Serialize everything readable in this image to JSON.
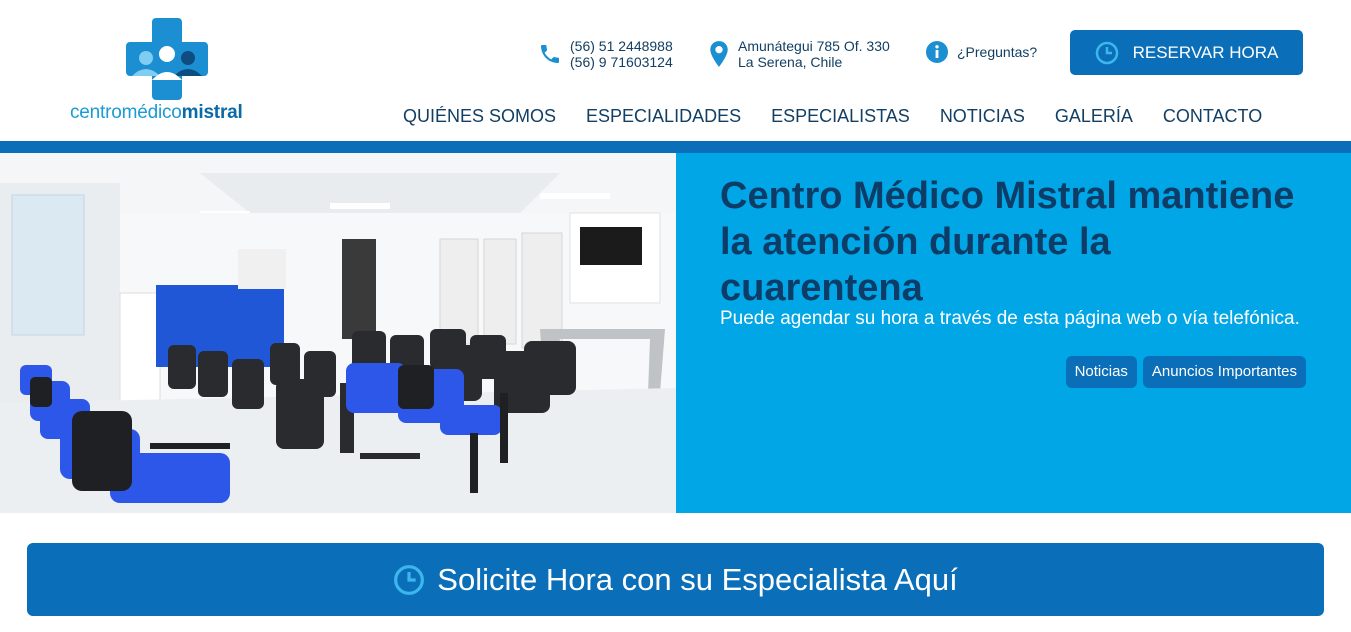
{
  "header": {
    "logo": {
      "text_light": "centro",
      "text_mid": "médico",
      "text_bold": "mistral"
    },
    "phone": {
      "icon": "phone-icon",
      "line1": "(56) 51 2448988",
      "line2": "(56) 9 71603124"
    },
    "address": {
      "icon": "map-pin-icon",
      "line1": "Amunátegui 785 Of. 330",
      "line2": "La Serena, Chile"
    },
    "faq": {
      "icon": "info-icon",
      "label": "¿Preguntas?"
    },
    "reserve_button": {
      "icon": "clock-icon",
      "label": "RESERVAR HORA"
    }
  },
  "nav": {
    "items": [
      {
        "label": "QUIÉNES SOMOS"
      },
      {
        "label": "ESPECIALIDADES"
      },
      {
        "label": "ESPECIALISTAS"
      },
      {
        "label": "NOTICIAS"
      },
      {
        "label": "GALERÍA"
      },
      {
        "label": "CONTACTO"
      }
    ]
  },
  "hero": {
    "title": "Centro Médico Mistral mantiene la atención durante la cuarentena",
    "text": "Puede agendar su hora a través de esta página web o vía telefónica.",
    "tags": [
      {
        "label": "Noticias"
      },
      {
        "label": "Anuncios Importantes"
      }
    ]
  },
  "cta": {
    "icon": "clock-icon",
    "label": "Solicite Hora con su Especialista Aquí"
  },
  "colors": {
    "brand_dark": "#0a6fb8",
    "brand_light": "#00a6e6",
    "text_dark": "#123f63"
  }
}
